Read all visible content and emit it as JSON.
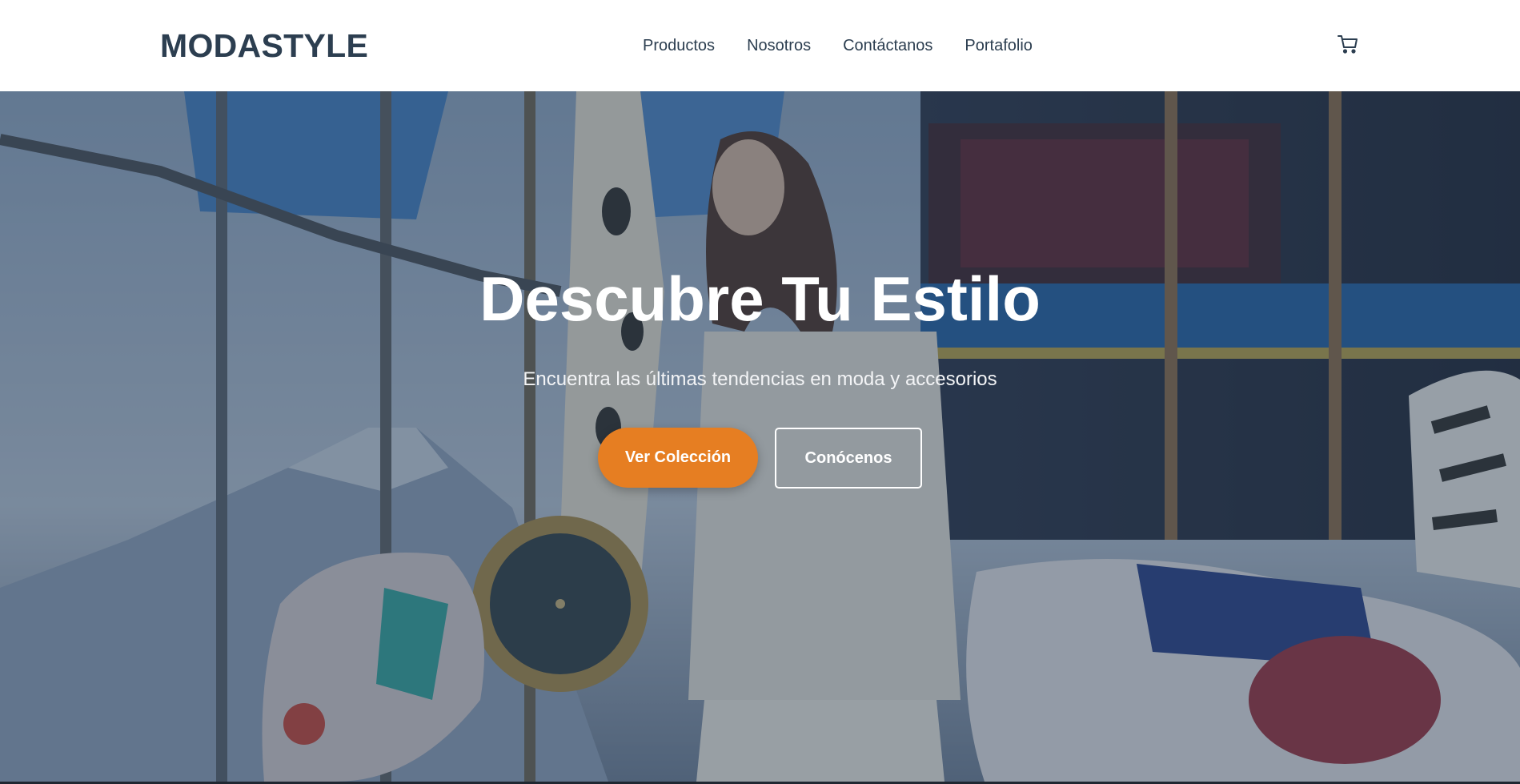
{
  "header": {
    "logo": "MODASTYLE",
    "nav": [
      {
        "label": "Productos"
      },
      {
        "label": "Nosotros"
      },
      {
        "label": "Contáctanos"
      },
      {
        "label": "Portafolio"
      }
    ],
    "cart_icon": "cart-icon"
  },
  "hero": {
    "title": "Descubre Tu Estilo",
    "subtitle": "Encuentra las últimas tendencias en moda y accesorios",
    "primary_button": "Ver Colección",
    "secondary_button": "Conócenos",
    "background_image": "carousel-fashion-scene"
  },
  "colors": {
    "brand_text": "#2c3e50",
    "accent": "#e67e22",
    "overlay": "#2c3e50"
  }
}
